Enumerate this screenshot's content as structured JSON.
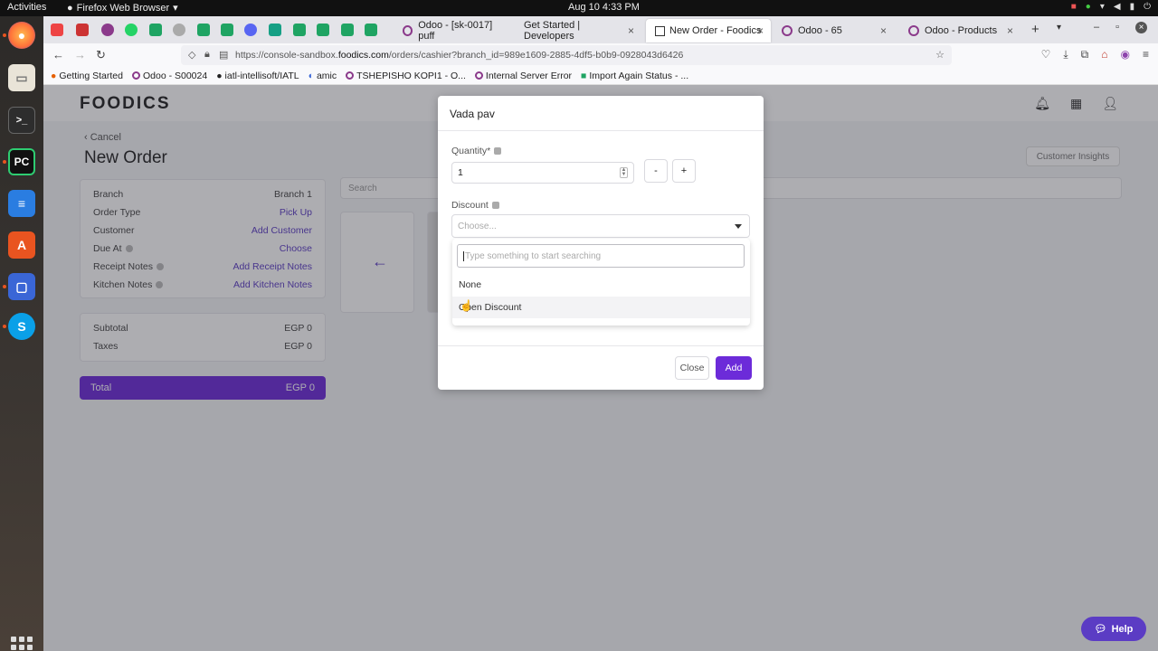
{
  "system": {
    "activities": "Activities",
    "app_name": "Firefox Web Browser",
    "clock": "Aug 10  4:33 PM"
  },
  "browser": {
    "tabs": [
      {
        "label": "Odoo - [sk-0017] puff"
      },
      {
        "label": "Get Started | Developers"
      },
      {
        "label": "New Order - Foodics"
      },
      {
        "label": "Odoo - 65"
      },
      {
        "label": "Odoo - Products"
      }
    ],
    "url_prefix": "https://console-sandbox.",
    "url_host": "foodics.com",
    "url_path": "/orders/cashier?branch_id=989e1609-2885-4df5-b0b9-0928043d6426",
    "bookmarks": [
      {
        "label": "Getting Started"
      },
      {
        "label": "Odoo - S00024"
      },
      {
        "label": "iatl-intellisoft/IATL"
      },
      {
        "label": "amic"
      },
      {
        "label": "TSHEPISHO KOPI1 - O..."
      },
      {
        "label": "Internal Server Error"
      },
      {
        "label": "Import Again Status - ..."
      }
    ]
  },
  "page": {
    "logo": "FOODICS",
    "cancel": "Cancel",
    "title": "New Order",
    "customer_insights": "Customer Insights",
    "search_placeholder": "Search",
    "order_details": [
      {
        "label": "Branch",
        "value": "Branch 1"
      },
      {
        "label": "Order Type",
        "value": "Pick Up"
      },
      {
        "label": "Customer",
        "value": "Add Customer"
      },
      {
        "label": "Due At",
        "value": "Choose"
      },
      {
        "label": "Receipt Notes",
        "value": "Add Receipt Notes"
      },
      {
        "label": "Kitchen Notes",
        "value": "Add Kitchen Notes"
      }
    ],
    "subtotal_label": "Subtotal",
    "subtotal_value": "EGP 0",
    "taxes_label": "Taxes",
    "taxes_value": "EGP 0",
    "total_label": "Total",
    "total_value": "EGP 0",
    "help": "Help"
  },
  "modal": {
    "title": "Vada pav",
    "quantity_label": "Quantity*",
    "quantity_value": "1",
    "minus": "-",
    "plus": "+",
    "discount_label": "Discount",
    "discount_placeholder": "Choose...",
    "search_placeholder": "Type something to start searching",
    "options": [
      "None",
      "Open Discount"
    ],
    "close": "Close",
    "add": "Add"
  },
  "colors": {
    "brand_purple": "#6c2bd9",
    "link_purple": "#5b3cc4"
  }
}
